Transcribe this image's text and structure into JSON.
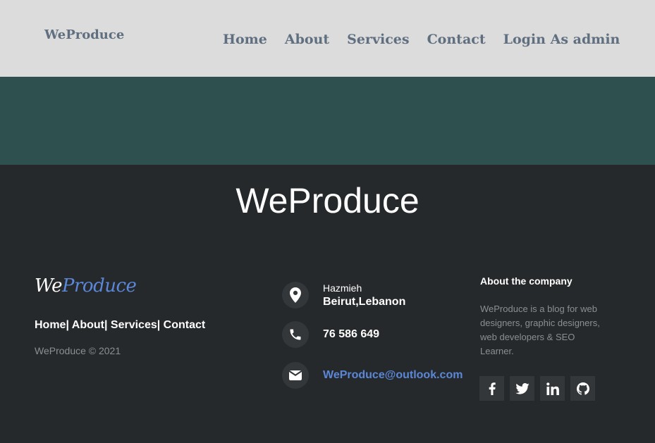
{
  "header": {
    "brand": "WeProduce",
    "nav": [
      {
        "label": "Home"
      },
      {
        "label": "About"
      },
      {
        "label": "Services"
      },
      {
        "label": "Contact"
      },
      {
        "label": "Login As admin"
      }
    ]
  },
  "footer": {
    "title": "WeProduce",
    "logo": {
      "we": "We",
      "produce": "Produce"
    },
    "links": [
      {
        "label": "Home"
      },
      {
        "label": "About"
      },
      {
        "label": "Services"
      },
      {
        "label": "Contact"
      }
    ],
    "link_separator": "| ",
    "copyright": "WeProduce © 2021",
    "contact": {
      "address_line1": "Hazmieh",
      "address_line2": "Beirut,Lebanon",
      "phone": "76 586 649",
      "email": "WeProduce@outlook.com"
    },
    "about": {
      "title": "About the company",
      "text": "WeProduce is a blog for web designers, graphic designers, web developers & SEO Learner."
    },
    "socials": [
      {
        "icon": "facebook-icon"
      },
      {
        "icon": "twitter-icon"
      },
      {
        "icon": "linkedin-icon"
      },
      {
        "icon": "github-icon"
      }
    ]
  },
  "colors": {
    "header_bg": "#dcdcdc",
    "banner_bg": "#2e504e",
    "footer_bg": "#26292b",
    "accent": "#5b87d8",
    "nav_text": "#5f6f7f"
  }
}
